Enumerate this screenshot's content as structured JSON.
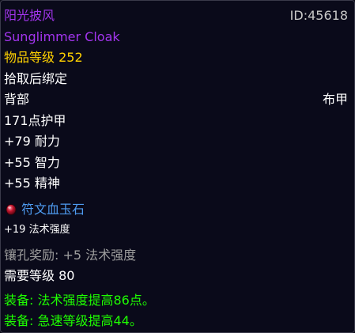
{
  "item": {
    "name_cn": "阳光披风",
    "id_label": "ID:45618",
    "name_en": "Sunglimmer Cloak",
    "item_level": "物品等级 252",
    "binding": "拾取后绑定",
    "slot": "背部",
    "armor_type": "布甲",
    "armor": "171点护甲",
    "stats": [
      "+79 耐力",
      "+55 智力",
      "+55 精神"
    ],
    "gem": {
      "icon": "red-gem-icon",
      "name": "符文血玉石",
      "bonus": "+19 法术强度"
    },
    "socket_bonus": "镶孔奖励: +5 法术强度",
    "required_level": "需要等级 80",
    "equip_effects": [
      "装备: 法术强度提高86点。",
      "装备: 急速等级提高44。"
    ]
  },
  "colors": {
    "epic": "#a335ee",
    "item_level": "#ffd100",
    "equip": "#1eff00",
    "socket_bonus": "#9d9d9d",
    "gem_name": "#4e9bf0",
    "background": "#0a0a1a"
  }
}
